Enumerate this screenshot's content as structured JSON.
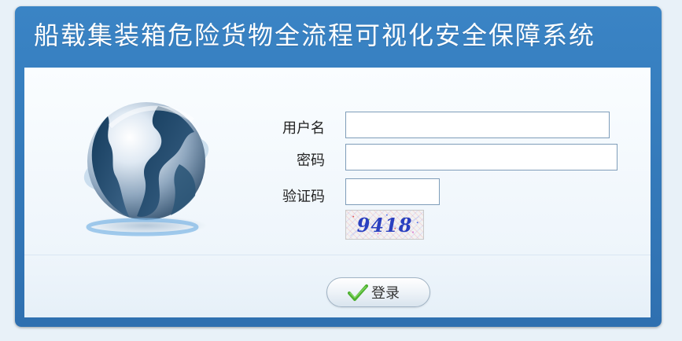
{
  "window": {
    "title": "船载集装箱危险货物全流程可视化安全保障系统"
  },
  "icons": {
    "globe": "globe-icon",
    "login": "check-icon"
  },
  "form": {
    "username_label": "用户名",
    "username_value": "",
    "password_label": "密码",
    "password_value": "",
    "captcha_label": "验证码",
    "captcha_value": "",
    "captcha_code": "9418"
  },
  "actions": {
    "login_label": "登录"
  },
  "colors": {
    "header_blue": "#2f70b0",
    "panel_background": "#eef5fb",
    "check_green": "#4caf2f"
  }
}
